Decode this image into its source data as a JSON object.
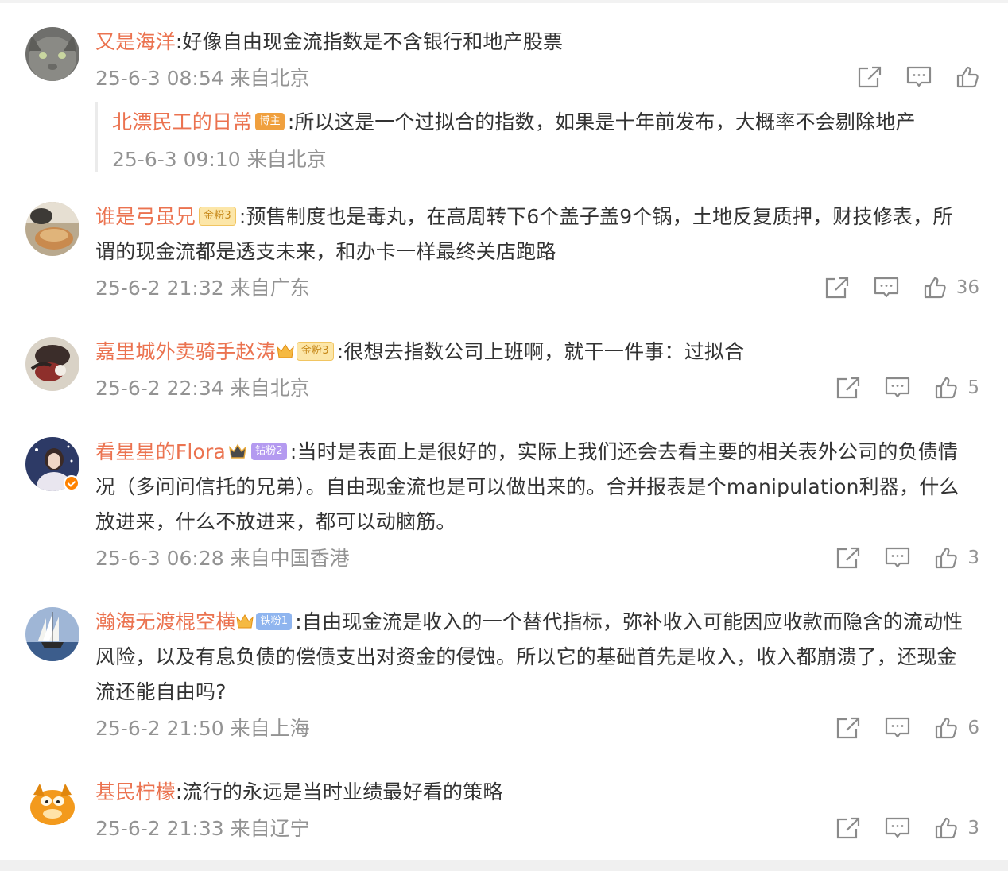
{
  "comments": [
    {
      "username": "又是海洋",
      "content": ":好像自由现金流指数是不含银行和地产股票",
      "time": "25-6-3 08:54 来自北京",
      "likes": "",
      "avatar": "cat-avatar",
      "reply": {
        "username": "北漂民工的日常",
        "badge": "博主",
        "content": ":所以这是一个过拟合的指数，如果是十年前发布，大概率不会剔除地产",
        "time": "25-6-3 09:10 来自北京"
      }
    },
    {
      "username": "谁是弓虽兄",
      "badge": "金粉3",
      "content": ":预售制度也是毒丸，在高周转下6个盖子盖9个锅，土地反复质押，财技修表，所谓的现金流都是透支未来，和办卡一样最终关店跑路",
      "time": "25-6-2 21:32 来自广东",
      "likes": "36",
      "avatar": "food-avatar"
    },
    {
      "username": "嘉里城外卖骑手赵涛",
      "badge": "金粉3",
      "content": ":很想去指数公司上班啊，就干一件事：过拟合",
      "time": "25-6-2 22:34 来自北京",
      "likes": "5",
      "avatar": "art-avatar"
    },
    {
      "username": "看星星的Flora",
      "badge": "钻粉2",
      "content": ":当时是表面上是很好的，实际上我们还会去看主要的相关表外公司的负债情况（多问问信托的兄弟）。自由现金流也是可以做出来的。合并报表是个manipulation利器，什么放进来，什么不放进来，都可以动脑筋。",
      "time": "25-6-3 06:28 来自中国香港",
      "likes": "3",
      "avatar": "woman-avatar"
    },
    {
      "username": "瀚海无渡棍空横",
      "badge": "铁粉1",
      "content": ":自由现金流是收入的一个替代指标，弥补收入可能因应收款而隐含的流动性风险，以及有息负债的偿债支出对资金的侵蚀。所以它的基础首先是收入，收入都崩溃了，还现金流还能自由吗?",
      "time": "25-6-2 21:50 来自上海",
      "likes": "6",
      "avatar": "ship-avatar"
    },
    {
      "username": "基民柠檬",
      "content": ":流行的永远是当时业绩最好看的策略",
      "time": "25-6-2 21:33 来自辽宁",
      "likes": "3",
      "avatar": "garfield-avatar"
    }
  ],
  "colors": {
    "username": "#eb7350",
    "text": "#333333",
    "meta": "#939393"
  },
  "icons": [
    "share-icon",
    "comment-icon",
    "like-icon"
  ]
}
